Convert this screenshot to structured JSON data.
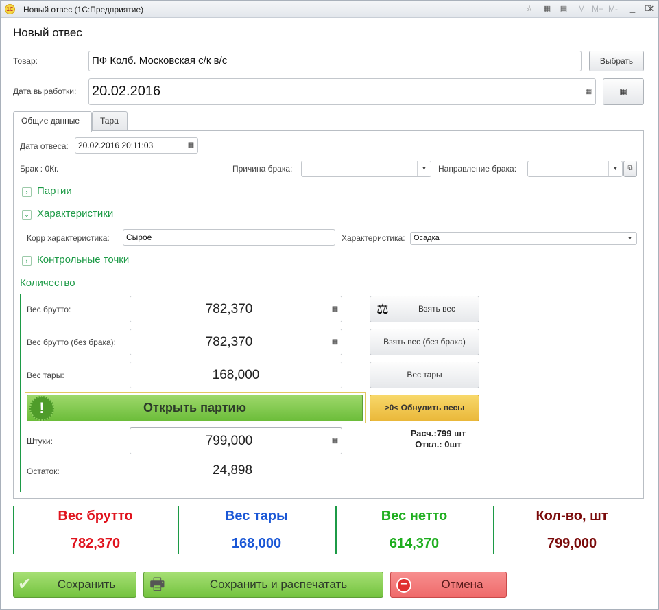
{
  "window": {
    "logo_text": "1С",
    "title": "Новый отвес  (1С:Предприятие)",
    "m_buttons": [
      "M",
      "M+",
      "M-"
    ]
  },
  "form": {
    "title": "Новый отвес"
  },
  "product": {
    "label": "Товар:",
    "value": "ПФ Колб. Московская с/к в/с",
    "select_button": "Выбрать"
  },
  "production_date": {
    "label": "Дата выработки:",
    "value": "20.02.2016"
  },
  "tabs": [
    {
      "label": "Общие данные",
      "active": true
    },
    {
      "label": "Тара",
      "active": false
    }
  ],
  "general": {
    "weigh_date_label": "Дата отвеса:",
    "weigh_date_value": "20.02.2016 20:11:03",
    "defect_text": "Брак : 0Кг.",
    "defect_reason_label": "Причина брака:",
    "defect_reason_value": "",
    "defect_direction_label": "Направление брака:",
    "defect_direction_value": ""
  },
  "sections": {
    "batches": "Партии",
    "characteristics": "Характеристики",
    "control_points": "Контрольные точки"
  },
  "characteristics": {
    "corr_label": "Корр характеристика:",
    "corr_value": "Сырое",
    "char_label": "Характеристика:",
    "char_value": "Осадка"
  },
  "quantity": {
    "title": "Количество",
    "gross_label": "Вес брутто:",
    "gross_value": "782,370",
    "gross_no_defect_label": "Вес брутто (без брака):",
    "gross_no_defect_value": "782,370",
    "tare_label": "Вес тары:",
    "tare_value": "168,000",
    "open_batch_button": "Открыть партию",
    "pieces_label": "Штуки:",
    "pieces_value": "799,000",
    "remainder_label": "Остаток:",
    "remainder_value": "24,898",
    "take_weight_button": "Взять вес",
    "take_weight_no_defect_button": "Взять вес (без брака)",
    "tare_button": "Вес тары",
    "reset_scales_button": ">0< Обнулить весы",
    "calc_text": "Расч.:799 шт",
    "deviation_text": "Откл.: 0шт"
  },
  "summary": [
    {
      "title": "Вес брутто",
      "value": "782,370",
      "color": "#e0141e"
    },
    {
      "title": "Вес  тары",
      "value": "168,000",
      "color": "#1a57d6"
    },
    {
      "title": "Вес нетто",
      "value": "614,370",
      "color": "#1fae1f"
    },
    {
      "title": "Кол-во, шт",
      "value": "799,000",
      "color": "#7a0a0a"
    }
  ],
  "actions": {
    "save": "Сохранить",
    "save_print": "Сохранить и распечатать",
    "cancel": "Отмена"
  }
}
